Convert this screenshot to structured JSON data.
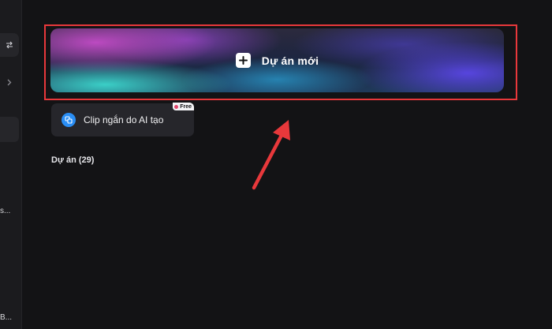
{
  "sidebar": {
    "swap_icon": "swap-arrows-icon",
    "chevron_icon": "chevron-right-icon",
    "items": [
      {
        "label": "s..."
      },
      {
        "label": "B..."
      }
    ]
  },
  "main": {
    "new_project": {
      "label": "Dự án mới",
      "icon": "plus-icon"
    },
    "clip_card": {
      "label": "Clip ngắn do AI tạo",
      "icon": "clip-icon",
      "badge": "Free"
    },
    "projects": {
      "heading": "Dự án",
      "count": "(29)"
    }
  },
  "annotation": {
    "highlight_color": "#e8383b",
    "arrow_color": "#e8383b"
  }
}
